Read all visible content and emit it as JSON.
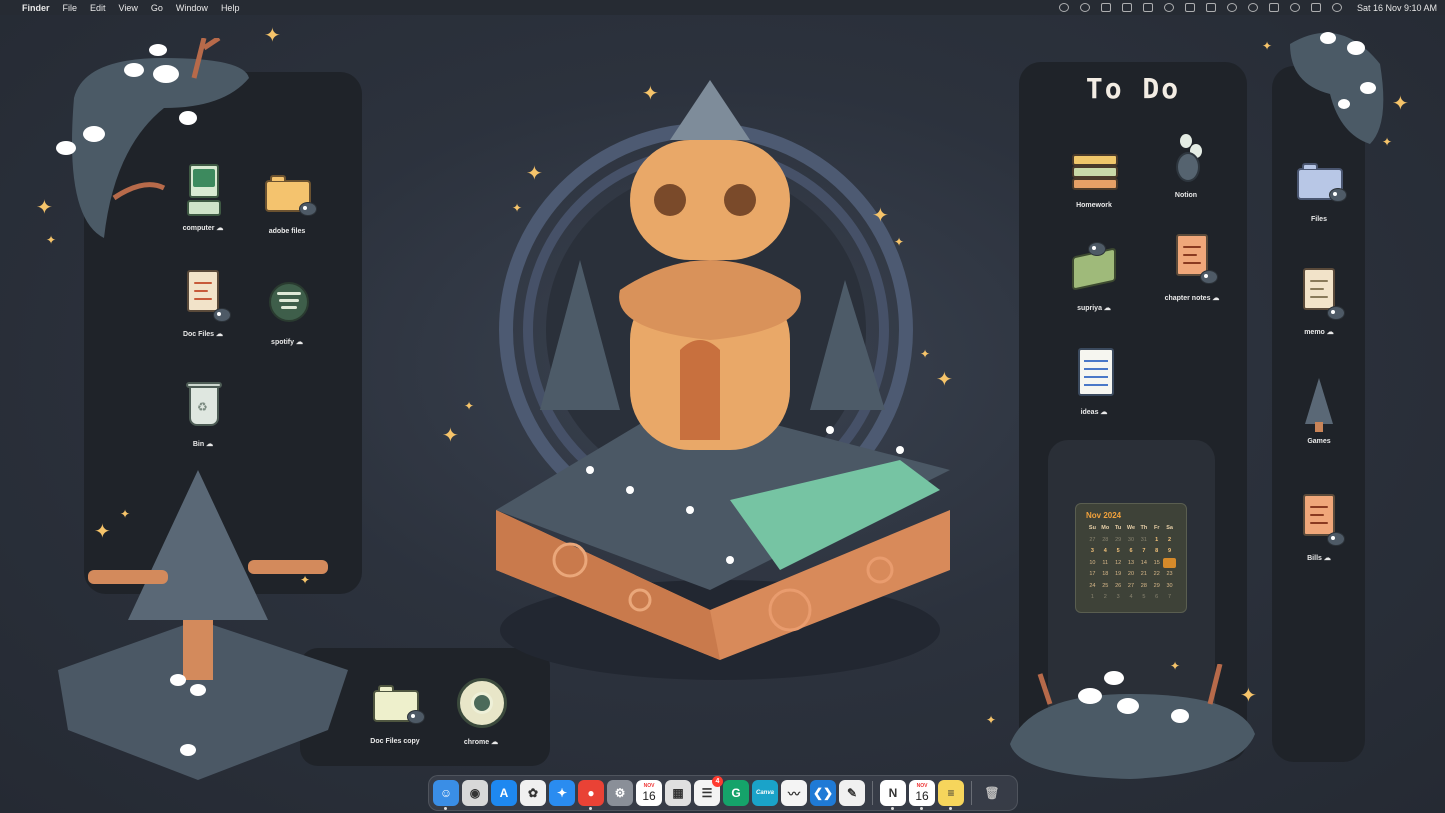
{
  "menubar": {
    "apple": "",
    "app_name": "Finder",
    "menus": [
      "File",
      "Edit",
      "View",
      "Go",
      "Window",
      "Help"
    ],
    "clock": "Sat 16 Nov  9:10 AM"
  },
  "left_panel": {
    "icons": [
      {
        "label": "computer",
        "cloud": "☁",
        "art": "computer-icon"
      },
      {
        "label": "adobe files",
        "cloud": "",
        "art": "folder-icon"
      },
      {
        "label": "Doc Files",
        "cloud": "☁",
        "art": "document-icon"
      },
      {
        "label": "spotify",
        "cloud": "☁",
        "art": "spotify-icon"
      },
      {
        "label": "Bin",
        "cloud": "☁",
        "art": "bin-icon"
      }
    ]
  },
  "bottom_panel": {
    "icons": [
      {
        "label": "Doc Files copy",
        "cloud": "",
        "art": "folder-icon"
      },
      {
        "label": "chrome",
        "cloud": "☁",
        "art": "chrome-icon"
      }
    ]
  },
  "todo_panel": {
    "title": "To Do",
    "icons": [
      {
        "label": "Homework",
        "cloud": "",
        "art": "books-icon"
      },
      {
        "label": "Notion",
        "cloud": "",
        "art": "notion-plant-icon"
      },
      {
        "label": "supriya",
        "cloud": "☁",
        "art": "book-icon"
      },
      {
        "label": "chapter notes",
        "cloud": "☁",
        "art": "document-icon"
      },
      {
        "label": "ideas",
        "cloud": "☁",
        "art": "notepad-icon"
      }
    ]
  },
  "calendar": {
    "title": "Nov 2024",
    "weekdays": [
      "Su",
      "Mo",
      "Tu",
      "We",
      "Th",
      "Fr",
      "Sa"
    ],
    "weeks": [
      [
        "27",
        "28",
        "29",
        "30",
        "31",
        "1",
        "2"
      ],
      [
        "3",
        "4",
        "5",
        "6",
        "7",
        "8",
        "9"
      ],
      [
        "10",
        "11",
        "12",
        "13",
        "14",
        "15",
        "16"
      ],
      [
        "17",
        "18",
        "19",
        "20",
        "21",
        "22",
        "23"
      ],
      [
        "24",
        "25",
        "26",
        "27",
        "28",
        "29",
        "30"
      ],
      [
        "1",
        "2",
        "3",
        "4",
        "5",
        "6",
        "7"
      ]
    ],
    "today": "16",
    "accent": "#f2a23c"
  },
  "right_panel": {
    "icons": [
      {
        "label": "Files",
        "cloud": "",
        "art": "folder-icon"
      },
      {
        "label": "memo",
        "cloud": "☁",
        "art": "document-icon"
      },
      {
        "label": "Games",
        "cloud": "",
        "art": "tree-icon"
      },
      {
        "label": "Bills",
        "cloud": "☁",
        "art": "document-icon"
      }
    ]
  },
  "dock": {
    "apps": [
      {
        "name": "Finder",
        "icon": "finder-icon",
        "glyph": "☺",
        "color": "#3a8ee6",
        "running": true
      },
      {
        "name": "Screenshot",
        "icon": "screenshot-icon",
        "glyph": "◉",
        "color": "#d8d8d8",
        "running": false
      },
      {
        "name": "App Store",
        "icon": "app-store-icon",
        "glyph": "A",
        "color": "#1e88f0",
        "running": false
      },
      {
        "name": "Photos",
        "icon": "photos-icon",
        "glyph": "✿",
        "color": "#f0f0f0",
        "running": false
      },
      {
        "name": "Safari",
        "icon": "safari-icon",
        "glyph": "✦",
        "color": "#2a8cf0",
        "running": false
      },
      {
        "name": "Chrome",
        "icon": "chrome-icon",
        "glyph": "●",
        "color": "#e94235",
        "running": true
      },
      {
        "name": "System Settings",
        "icon": "gear-icon",
        "glyph": "⚙",
        "color": "#8a8f98",
        "running": false
      },
      {
        "name": "Calendar",
        "icon": "calendar-icon",
        "glyph": "",
        "color": "#ffffff",
        "running": false,
        "month": "NOV",
        "day": "16"
      },
      {
        "name": "Launchpad",
        "icon": "launchpad-icon",
        "glyph": "▦",
        "color": "#e0e0e0",
        "running": false
      },
      {
        "name": "Reminders",
        "icon": "reminders-icon",
        "glyph": "☰",
        "color": "#f4f4f4",
        "running": false,
        "badge": "4"
      },
      {
        "name": "Grammarly",
        "icon": "grammarly-icon",
        "glyph": "G",
        "color": "#15a36a",
        "running": false
      },
      {
        "name": "Canva",
        "icon": "canva-icon",
        "glyph": "Canva",
        "color": "#1aa3c9",
        "running": false
      },
      {
        "name": "Freeform",
        "icon": "freeform-icon",
        "glyph": "〰",
        "color": "#f4f4f4",
        "running": false
      },
      {
        "name": "VS Code",
        "icon": "vscode-icon",
        "glyph": "❮❯",
        "color": "#1f7ad6",
        "running": false
      },
      {
        "name": "Pages",
        "icon": "pages-icon",
        "glyph": "✎",
        "color": "#f0f0f0",
        "running": false
      },
      {
        "name": "Notion",
        "icon": "notion-icon",
        "glyph": "N",
        "color": "#ffffff",
        "running": true
      },
      {
        "name": "Calendar 2",
        "icon": "calendar-icon",
        "glyph": "",
        "color": "#ffffff",
        "running": true,
        "month": "NOV",
        "day": "16"
      },
      {
        "name": "Notes",
        "icon": "notes-icon",
        "glyph": "≡",
        "color": "#f6d55c",
        "running": true
      },
      {
        "name": "Trash",
        "icon": "trash-icon",
        "glyph": "🗑",
        "color": "transparent",
        "running": false
      }
    ]
  }
}
